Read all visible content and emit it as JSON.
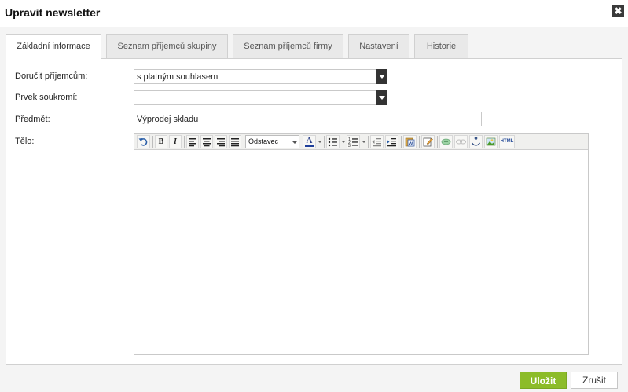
{
  "dialog": {
    "title": "Upravit newsletter",
    "close_glyph": "✖"
  },
  "tabs": [
    {
      "label": "Základní informace",
      "active": true
    },
    {
      "label": "Seznam příjemců skupiny",
      "active": false
    },
    {
      "label": "Seznam příjemců firmy",
      "active": false
    },
    {
      "label": "Nastavení",
      "active": false
    },
    {
      "label": "Historie",
      "active": false
    }
  ],
  "form": {
    "deliver_label": "Doručit příjemcům:",
    "deliver_value": "s platným souhlasem",
    "privacy_label": "Prvek soukromí:",
    "privacy_value": "",
    "subject_label": "Předmět:",
    "subject_value": "Výprodej skladu",
    "body_label": "Tělo:"
  },
  "editor": {
    "format_value": "Odstavec",
    "toolbar_icons": [
      "undo-icon",
      "bold-icon",
      "italic-icon",
      "align-left-icon",
      "align-center-icon",
      "align-right-icon",
      "align-justify-icon",
      "format-select",
      "font-color-icon",
      "bullet-list-icon",
      "numbered-list-icon",
      "outdent-icon",
      "indent-icon",
      "paste-word-icon",
      "edit-icon",
      "link-icon",
      "unlink-icon",
      "anchor-icon",
      "image-icon",
      "html-icon"
    ],
    "bold_glyph": "B",
    "italic_glyph": "I",
    "font_color_glyph": "A",
    "html_glyph": "HTML"
  },
  "actions": {
    "save_label": "Uložit",
    "cancel_label": "Zrušit"
  },
  "colors": {
    "save_green": "#8cbc29",
    "dark_arrow": "#333333"
  }
}
